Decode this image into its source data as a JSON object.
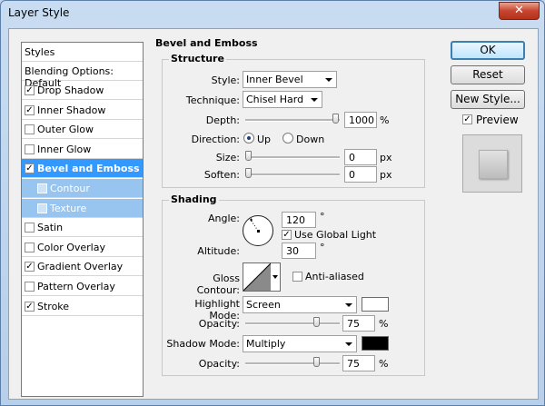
{
  "window": {
    "title": "Layer Style",
    "close_glyph": "✕"
  },
  "styles_list": {
    "header": "Styles",
    "blending": "Blending Options: Default",
    "items": [
      {
        "label": "Drop Shadow",
        "checked": true
      },
      {
        "label": "Inner Shadow",
        "checked": true
      },
      {
        "label": "Outer Glow",
        "checked": false
      },
      {
        "label": "Inner Glow",
        "checked": false
      },
      {
        "label": "Bevel and Emboss",
        "checked": true,
        "selected": true
      },
      {
        "label": "Contour",
        "checked": false,
        "sub": true
      },
      {
        "label": "Texture",
        "checked": false,
        "sub": true
      },
      {
        "label": "Satin",
        "checked": false
      },
      {
        "label": "Color Overlay",
        "checked": false
      },
      {
        "label": "Gradient Overlay",
        "checked": true
      },
      {
        "label": "Pattern Overlay",
        "checked": false
      },
      {
        "label": "Stroke",
        "checked": true
      }
    ]
  },
  "bevel": {
    "title": "Bevel and Emboss",
    "structure": {
      "title": "Structure",
      "style_label": "Style:",
      "style_value": "Inner Bevel",
      "technique_label": "Technique:",
      "technique_value": "Chisel Hard",
      "depth_label": "Depth:",
      "depth_value": "1000",
      "depth_unit": "%",
      "direction_label": "Direction:",
      "direction_up": "Up",
      "direction_down": "Down",
      "size_label": "Size:",
      "size_value": "0",
      "size_unit": "px",
      "soften_label": "Soften:",
      "soften_value": "0",
      "soften_unit": "px"
    },
    "shading": {
      "title": "Shading",
      "angle_label": "Angle:",
      "angle_value": "120",
      "angle_unit": "°",
      "global_light": "Use Global Light",
      "global_light_checked": true,
      "altitude_label": "Altitude:",
      "altitude_value": "30",
      "altitude_unit": "°",
      "gloss_label": "Gloss Contour:",
      "anti_aliased": "Anti-aliased",
      "anti_aliased_checked": false,
      "highlight_label": "Highlight Mode:",
      "highlight_value": "Screen",
      "highlight_color": "#ffffff",
      "highlight_opacity_label": "Opacity:",
      "highlight_opacity_value": "75",
      "opacity_unit": "%",
      "shadow_label": "Shadow Mode:",
      "shadow_value": "Multiply",
      "shadow_color": "#000000",
      "shadow_opacity_label": "Opacity:",
      "shadow_opacity_value": "75"
    }
  },
  "buttons": {
    "ok": "OK",
    "reset": "Reset",
    "new_style": "New Style...",
    "preview": "Preview",
    "preview_checked": true
  }
}
